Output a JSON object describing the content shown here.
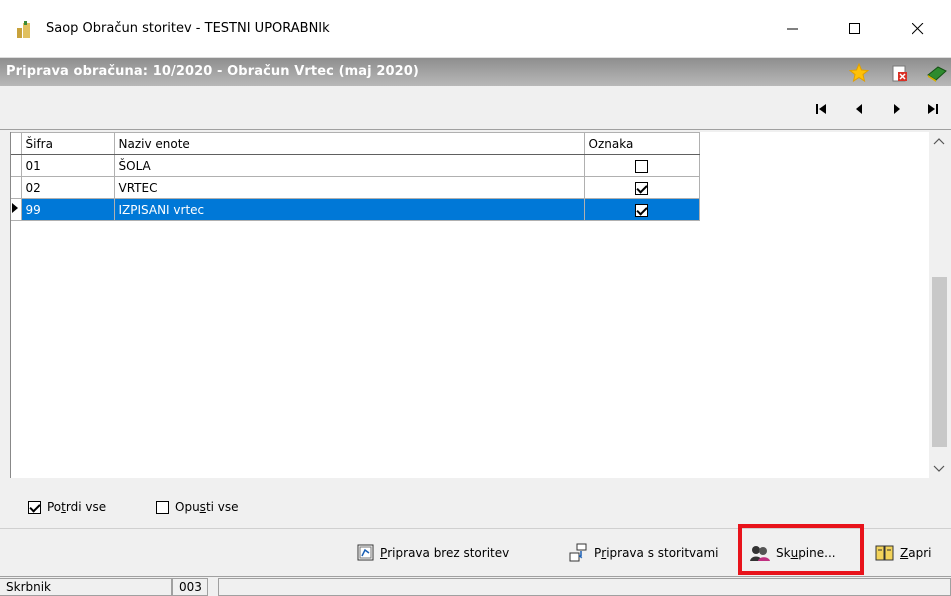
{
  "window": {
    "title": "Saop Obračun storitev - TESTNI UPORABNIk"
  },
  "header": {
    "title": "Priprava obračuna: 10/2020 - Obračun Vrtec (maj 2020)"
  },
  "table": {
    "columns": [
      "Šifra",
      "Naziv enote",
      "Oznaka"
    ],
    "rows": [
      {
        "sifra": "01",
        "naziv": "ŠOLA",
        "oznaka": false,
        "selected": false
      },
      {
        "sifra": "02",
        "naziv": "VRTEC",
        "oznaka": true,
        "selected": false
      },
      {
        "sifra": "99",
        "naziv": "IZPISANI vrtec",
        "oznaka": true,
        "selected": true
      }
    ]
  },
  "checks": {
    "potrdi_pre": "Po",
    "potrdi_u": "t",
    "potrdi_post": "rdi vse",
    "opusti_pre": "Opu",
    "opusti_u": "s",
    "opusti_post": "ti vse"
  },
  "buttons": {
    "brez_u": "P",
    "brez_post": "riprava brez storitev",
    "s_pre": "P",
    "s_u": "r",
    "s_post": "iprava s storitvami",
    "skupine_pre": "Sk",
    "skupine_u": "u",
    "skupine_post": "pine...",
    "zapri_u": "Z",
    "zapri_post": "apri"
  },
  "status": {
    "label": "Skrbnik",
    "code": "003"
  },
  "colors": {
    "selection": "#0078d7",
    "highlight": "#e8131b"
  }
}
